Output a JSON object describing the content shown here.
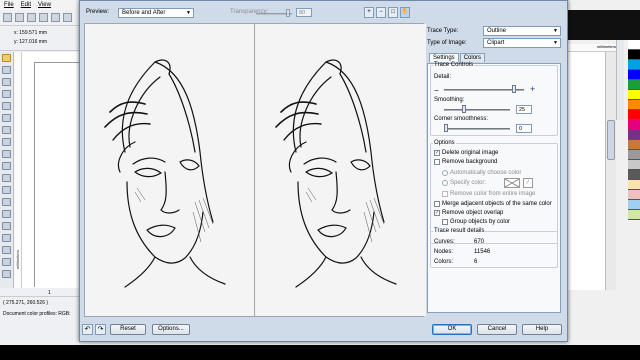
{
  "app": {
    "menu": [
      "File",
      "Edit",
      "View"
    ],
    "x_readout": "x: 159.571 mm",
    "y_readout": "y: 127.016 mm",
    "page_counter": "1 of 1",
    "cursor_coords": "( 275.271, 260.526 )",
    "status_text": "Document color profiles: RGB:",
    "ruler_units_h": "millimeters",
    "ruler_units_v": "millimeters",
    "palette": [
      "#ffffff",
      "#000000",
      "#00a0e3",
      "#0000ff",
      "#1a9e3a",
      "#ffff00",
      "#ff8a00",
      "#ff0000",
      "#e4007c",
      "#7a2e8c",
      "#c47a3a",
      "#9a9a9a",
      "#c8c8c8",
      "#5a5a5a",
      "#ffe0b0",
      "#f0c0c0",
      "#a0d0f0",
      "#d0e8a0"
    ]
  },
  "dialog": {
    "preview_label": "Preview:",
    "preview_value": "Before and After",
    "transparency_label": "Transparency:",
    "transparency_value": "80",
    "trace_type_label": "Trace Type:",
    "trace_type_value": "Outline",
    "image_type_label": "Type of Image:",
    "image_type_value": "Clipart",
    "tabs": [
      "Settings",
      "Colors"
    ],
    "trace_controls_label": "Trace Controls",
    "detail_label": "Detail:",
    "detail_level": 0.88,
    "smoothing_label": "Smoothing:",
    "smoothing_value": "25",
    "corner_label": "Corner smoothness:",
    "corner_value": "0",
    "options_label": "Options",
    "delete_original": "Delete original image",
    "remove_background": "Remove background",
    "auto_choose_color": "Automatically choose color",
    "specify_color": "Specify color:",
    "remove_color_entire": "Remove color from entire image",
    "merge_adjacent": "Merge adjacent objects of the same color",
    "remove_overlap": "Remove object overlap",
    "group_by_color": "Group objects by color",
    "results_label": "Trace result details",
    "curves_label": "Curves:",
    "curves_value": "670",
    "nodes_label": "Nodes:",
    "nodes_value": "11546",
    "colors_label": "Colors:",
    "colors_value": "6",
    "reset": "Reset",
    "options": "Options...",
    "ok": "OK",
    "cancel": "Cancel",
    "help": "Help"
  }
}
